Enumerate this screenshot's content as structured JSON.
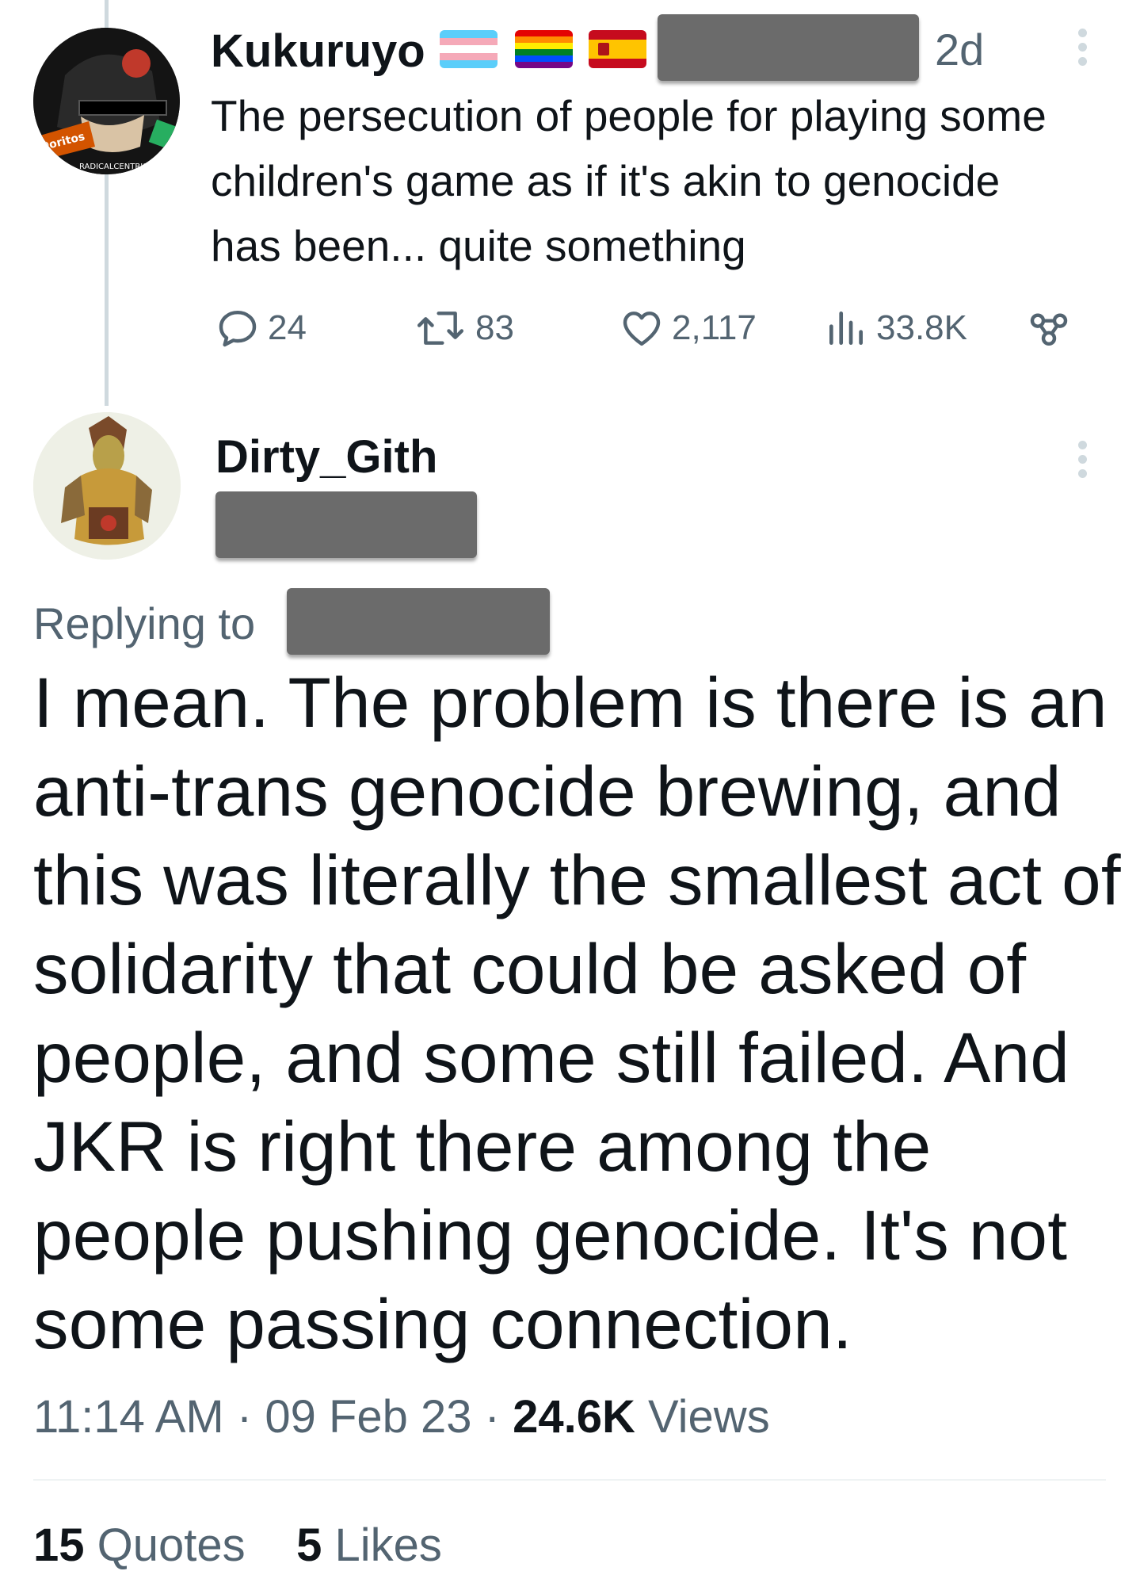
{
  "tweet1": {
    "author": "Kukuruyo",
    "flags": [
      "transgender-flag",
      "rainbow-flag",
      "spain-flag"
    ],
    "time": "2d",
    "text": "The persecution of people for playing some children's game as if it's akin to genocide has been... quite something",
    "replies": "24",
    "retweets": "83",
    "likes": "2,117",
    "views": "33.8K",
    "avatar_labels": [
      "Doritos",
      "RADICALCENTRISM"
    ]
  },
  "tweet2": {
    "author": "Dirty_Gith",
    "replying_label": "Replying to",
    "text": "I mean. The problem is there is an anti-trans genocide brewing, and this was literally the smallest act of solidarity that could be asked of people, and some still failed. And JKR is right there among the people pushing genocide. It's not some passing connection.",
    "time": "11:14 AM",
    "sep": "·",
    "date": "09 Feb 23",
    "views_count": "24.6K",
    "views_label": "Views",
    "quotes_count": "15",
    "quotes_label": "Quotes",
    "likes_count": "5",
    "likes_label": "Likes"
  },
  "colors": {
    "text": "#0f1419",
    "secondary": "#536471",
    "thread_line": "#cfd9de",
    "redaction": "#6b6b6b"
  }
}
